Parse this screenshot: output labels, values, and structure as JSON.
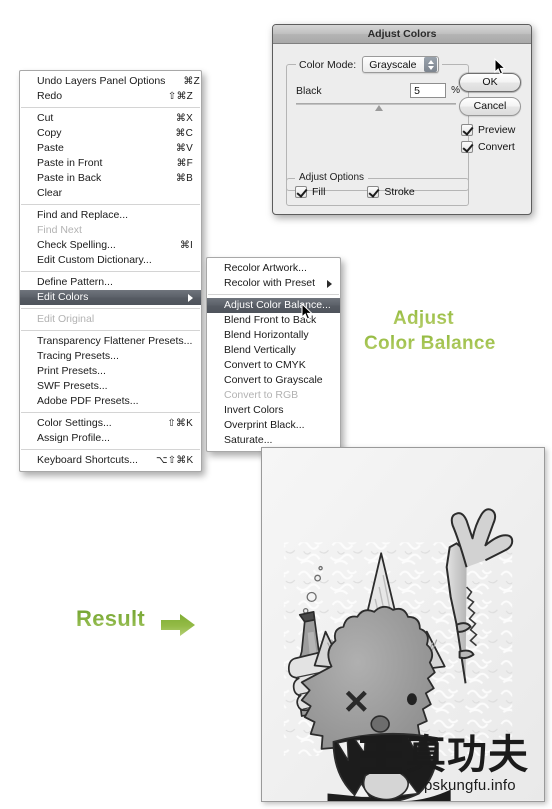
{
  "edit_menu": {
    "name": "Edit menu",
    "groups": [
      [
        {
          "label": "Undo Layers Panel Options",
          "shortcut": "⌘Z",
          "state": "normal"
        },
        {
          "label": "Redo",
          "shortcut": "⇧⌘Z",
          "state": "normal"
        }
      ],
      [
        {
          "label": "Cut",
          "shortcut": "⌘X",
          "state": "normal"
        },
        {
          "label": "Copy",
          "shortcut": "⌘C",
          "state": "normal"
        },
        {
          "label": "Paste",
          "shortcut": "⌘V",
          "state": "normal"
        },
        {
          "label": "Paste in Front",
          "shortcut": "⌘F",
          "state": "normal"
        },
        {
          "label": "Paste in Back",
          "shortcut": "⌘B",
          "state": "normal"
        },
        {
          "label": "Clear",
          "shortcut": "",
          "state": "normal"
        }
      ],
      [
        {
          "label": "Find and Replace...",
          "shortcut": "",
          "state": "normal"
        },
        {
          "label": "Find Next",
          "shortcut": "",
          "state": "disabled"
        },
        {
          "label": "Check Spelling...",
          "shortcut": "⌘I",
          "state": "normal"
        },
        {
          "label": "Edit Custom Dictionary...",
          "shortcut": "",
          "state": "normal"
        }
      ],
      [
        {
          "label": "Define Pattern...",
          "shortcut": "",
          "state": "normal"
        },
        {
          "label": "Edit Colors",
          "shortcut": "",
          "state": "selected",
          "has_submenu": true
        }
      ],
      [
        {
          "label": "Edit Original",
          "shortcut": "",
          "state": "disabled"
        }
      ],
      [
        {
          "label": "Transparency Flattener Presets...",
          "shortcut": "",
          "state": "normal"
        },
        {
          "label": "Tracing Presets...",
          "shortcut": "",
          "state": "normal"
        },
        {
          "label": "Print Presets...",
          "shortcut": "",
          "state": "normal"
        },
        {
          "label": "SWF Presets...",
          "shortcut": "",
          "state": "normal"
        },
        {
          "label": "Adobe PDF Presets...",
          "shortcut": "",
          "state": "normal"
        }
      ],
      [
        {
          "label": "Color Settings...",
          "shortcut": "⇧⌘K",
          "state": "normal"
        },
        {
          "label": "Assign Profile...",
          "shortcut": "",
          "state": "normal"
        }
      ],
      [
        {
          "label": "Keyboard Shortcuts...",
          "shortcut": "⌥⇧⌘K",
          "state": "normal"
        }
      ]
    ]
  },
  "edit_colors_submenu": {
    "name": "Edit Colors submenu",
    "groups": [
      [
        {
          "label": "Recolor Artwork...",
          "shortcut": "",
          "state": "normal"
        },
        {
          "label": "Recolor with Preset",
          "shortcut": "",
          "state": "normal",
          "has_submenu": true
        }
      ],
      [
        {
          "label": "Adjust Color Balance...",
          "shortcut": "",
          "state": "selected"
        },
        {
          "label": "Blend Front to Back",
          "shortcut": "",
          "state": "normal"
        },
        {
          "label": "Blend Horizontally",
          "shortcut": "",
          "state": "normal"
        },
        {
          "label": "Blend Vertically",
          "shortcut": "",
          "state": "normal"
        },
        {
          "label": "Convert to CMYK",
          "shortcut": "",
          "state": "normal"
        },
        {
          "label": "Convert to Grayscale",
          "shortcut": "",
          "state": "normal"
        },
        {
          "label": "Convert to RGB",
          "shortcut": "",
          "state": "disabled"
        },
        {
          "label": "Invert Colors",
          "shortcut": "",
          "state": "normal"
        },
        {
          "label": "Overprint Black...",
          "shortcut": "",
          "state": "normal"
        },
        {
          "label": "Saturate...",
          "shortcut": "",
          "state": "normal"
        }
      ]
    ]
  },
  "dialog": {
    "title": "Adjust Colors",
    "color_mode_label": "Color Mode:",
    "color_mode_value": "Grayscale",
    "color_mode_options": [
      "Grayscale"
    ],
    "black_label": "Black",
    "black_value": "5",
    "percent_symbol": "%",
    "adjust_options_title": "Adjust Options",
    "fill_label": "Fill",
    "stroke_label": "Stroke",
    "ok_label": "OK",
    "cancel_label": "Cancel",
    "preview_label": "Preview",
    "convert_label": "Convert"
  },
  "annotations": {
    "adjust": "Adjust",
    "color_balance": "Color Balance",
    "result": "Result"
  },
  "artwork": {
    "watermark_cn": "真功夫",
    "watermark_url": "pskungfu.info"
  },
  "colors": {
    "menu_highlight": "#5b6068",
    "annotation_green": "#9dbf4a",
    "result_green": "#7fae3c",
    "dialog_bg": "#ededed",
    "titlebar_bg": "#b9b9b9"
  }
}
